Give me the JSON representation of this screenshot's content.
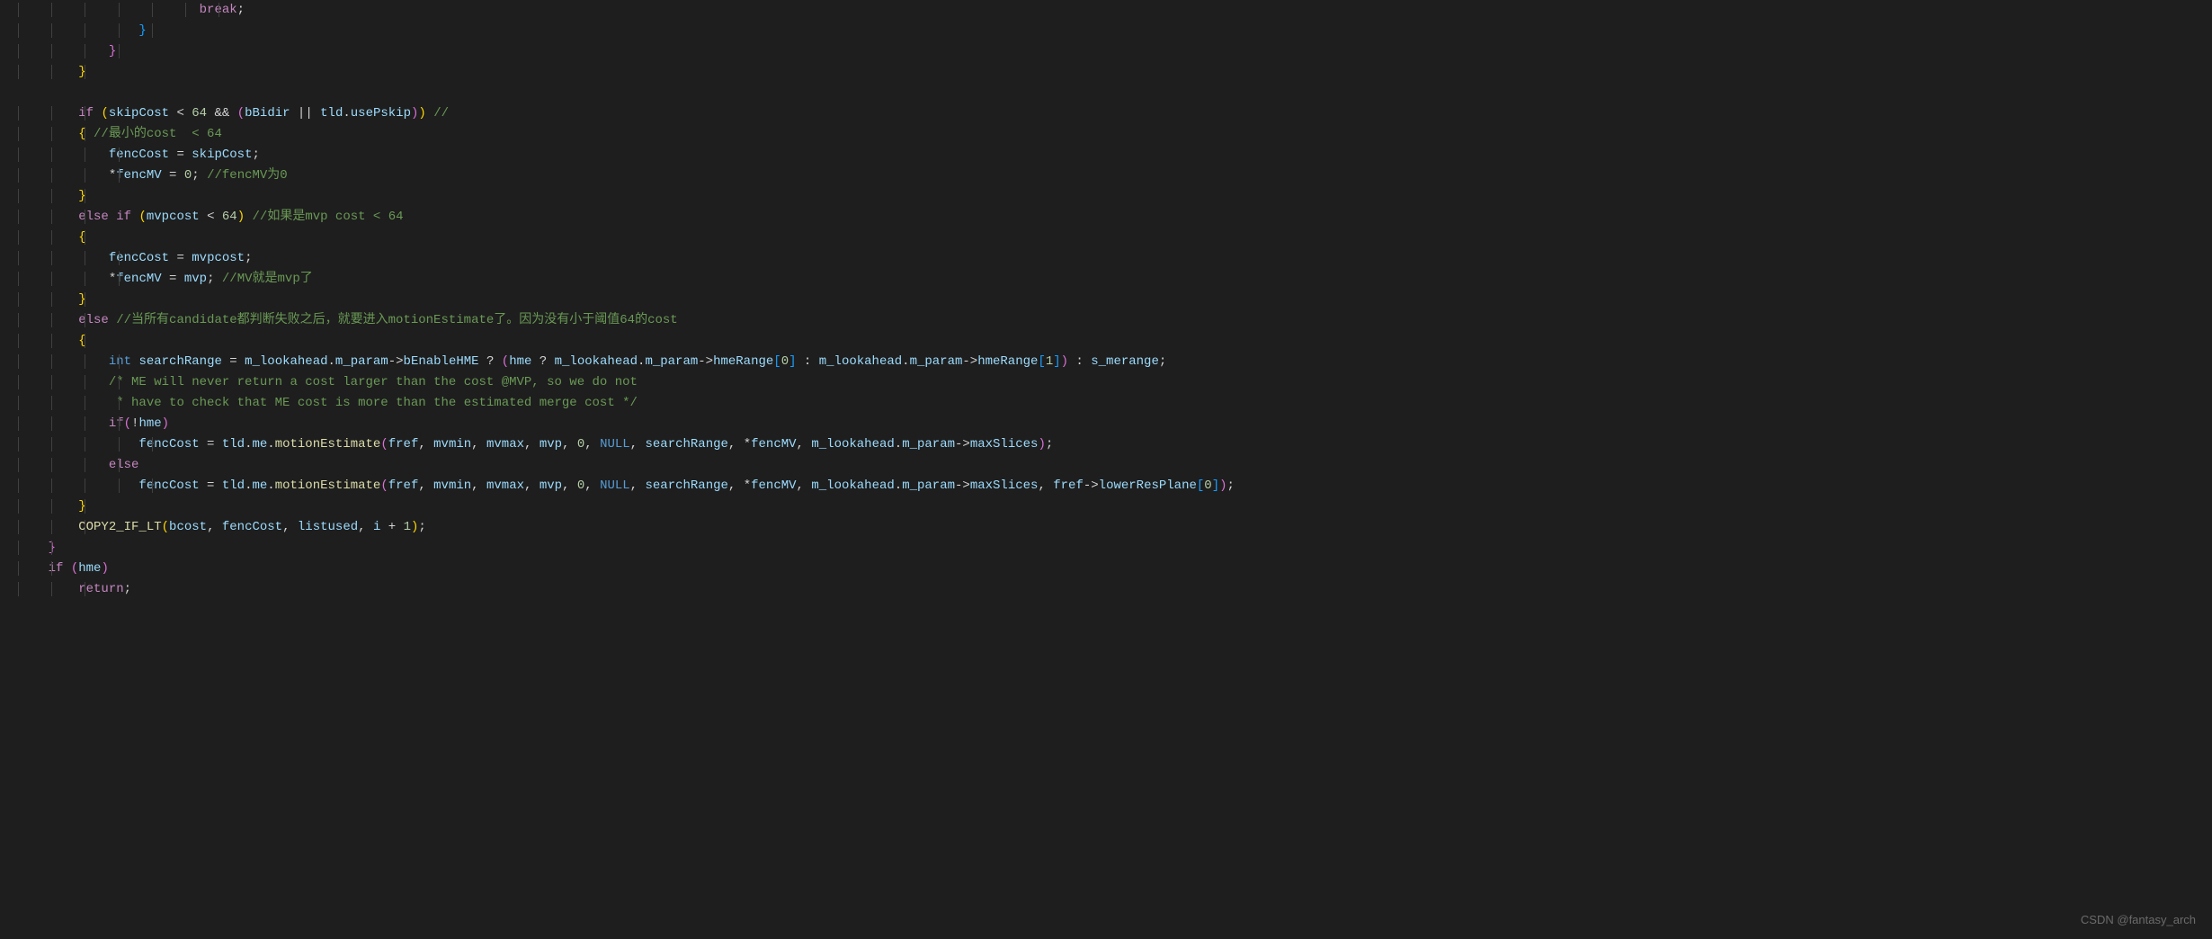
{
  "watermark": "CSDN @fantasy_arch",
  "code": {
    "lines": [
      {
        "indent": 24,
        "tokens": [
          {
            "t": "break",
            "c": "ctrl"
          },
          {
            "t": ";",
            "c": "white"
          }
        ]
      },
      {
        "indent": 16,
        "tokens": [
          {
            "t": "}",
            "c": "br3"
          }
        ]
      },
      {
        "indent": 12,
        "tokens": [
          {
            "t": "}",
            "c": "br2"
          }
        ]
      },
      {
        "indent": 8,
        "tokens": [
          {
            "t": "}",
            "c": "br1"
          }
        ]
      },
      {
        "indent": 0,
        "tokens": []
      },
      {
        "indent": 8,
        "tokens": [
          {
            "t": "if",
            "c": "kw"
          },
          {
            "t": " ",
            "c": "white"
          },
          {
            "t": "(",
            "c": "br1"
          },
          {
            "t": "skipCost",
            "c": "var"
          },
          {
            "t": " < ",
            "c": "white"
          },
          {
            "t": "64",
            "c": "num"
          },
          {
            "t": " && ",
            "c": "white"
          },
          {
            "t": "(",
            "c": "br2"
          },
          {
            "t": "bBidir",
            "c": "var"
          },
          {
            "t": " || ",
            "c": "white"
          },
          {
            "t": "tld",
            "c": "var"
          },
          {
            "t": ".",
            "c": "white"
          },
          {
            "t": "usePskip",
            "c": "prop"
          },
          {
            "t": ")",
            "c": "br2"
          },
          {
            "t": ")",
            "c": "br1"
          },
          {
            "t": " ",
            "c": "white"
          },
          {
            "t": "//",
            "c": "cmt"
          }
        ]
      },
      {
        "indent": 8,
        "tokens": [
          {
            "t": "{",
            "c": "br1"
          },
          {
            "t": " ",
            "c": "white"
          },
          {
            "t": "//最小的cost  < 64",
            "c": "cmt"
          }
        ]
      },
      {
        "indent": 12,
        "tokens": [
          {
            "t": "fencCost",
            "c": "var"
          },
          {
            "t": " = ",
            "c": "white"
          },
          {
            "t": "skipCost",
            "c": "var"
          },
          {
            "t": ";",
            "c": "white"
          }
        ]
      },
      {
        "indent": 12,
        "tokens": [
          {
            "t": "*",
            "c": "white"
          },
          {
            "t": "fencMV",
            "c": "var"
          },
          {
            "t": " = ",
            "c": "white"
          },
          {
            "t": "0",
            "c": "num"
          },
          {
            "t": ";",
            "c": "white"
          },
          {
            "t": " ",
            "c": "white"
          },
          {
            "t": "//fencMV为0",
            "c": "cmt"
          }
        ]
      },
      {
        "indent": 8,
        "tokens": [
          {
            "t": "}",
            "c": "br1"
          }
        ]
      },
      {
        "indent": 8,
        "tokens": [
          {
            "t": "else",
            "c": "kw"
          },
          {
            "t": " ",
            "c": "white"
          },
          {
            "t": "if",
            "c": "kw"
          },
          {
            "t": " ",
            "c": "white"
          },
          {
            "t": "(",
            "c": "br1"
          },
          {
            "t": "mvpcost",
            "c": "var"
          },
          {
            "t": " < ",
            "c": "white"
          },
          {
            "t": "64",
            "c": "num"
          },
          {
            "t": ")",
            "c": "br1"
          },
          {
            "t": " ",
            "c": "white"
          },
          {
            "t": "//如果是mvp cost < 64",
            "c": "cmt"
          }
        ]
      },
      {
        "indent": 8,
        "tokens": [
          {
            "t": "{",
            "c": "br1"
          }
        ]
      },
      {
        "indent": 12,
        "tokens": [
          {
            "t": "fencCost",
            "c": "var"
          },
          {
            "t": " = ",
            "c": "white"
          },
          {
            "t": "mvpcost",
            "c": "var"
          },
          {
            "t": ";",
            "c": "white"
          }
        ]
      },
      {
        "indent": 12,
        "tokens": [
          {
            "t": "*",
            "c": "white"
          },
          {
            "t": "fencMV",
            "c": "var"
          },
          {
            "t": " = ",
            "c": "white"
          },
          {
            "t": "mvp",
            "c": "var"
          },
          {
            "t": ";",
            "c": "white"
          },
          {
            "t": " ",
            "c": "white"
          },
          {
            "t": "//MV就是mvp了",
            "c": "cmt"
          }
        ]
      },
      {
        "indent": 8,
        "tokens": [
          {
            "t": "}",
            "c": "br1"
          }
        ]
      },
      {
        "indent": 8,
        "tokens": [
          {
            "t": "else",
            "c": "kw"
          },
          {
            "t": " ",
            "c": "white"
          },
          {
            "t": "//当所有candidate都判断失败之后，就要进入motionEstimate了。因为没有小于阈值64的cost",
            "c": "cmt"
          }
        ]
      },
      {
        "indent": 8,
        "tokens": [
          {
            "t": "{",
            "c": "br1"
          }
        ]
      },
      {
        "indent": 12,
        "tokens": [
          {
            "t": "int",
            "c": "type"
          },
          {
            "t": " ",
            "c": "white"
          },
          {
            "t": "searchRange",
            "c": "var"
          },
          {
            "t": " = ",
            "c": "white"
          },
          {
            "t": "m_lookahead",
            "c": "var"
          },
          {
            "t": ".",
            "c": "white"
          },
          {
            "t": "m_param",
            "c": "prop"
          },
          {
            "t": "->",
            "c": "white"
          },
          {
            "t": "bEnableHME",
            "c": "prop"
          },
          {
            "t": " ? ",
            "c": "white"
          },
          {
            "t": "(",
            "c": "br2"
          },
          {
            "t": "hme",
            "c": "var"
          },
          {
            "t": " ? ",
            "c": "white"
          },
          {
            "t": "m_lookahead",
            "c": "var"
          },
          {
            "t": ".",
            "c": "white"
          },
          {
            "t": "m_param",
            "c": "prop"
          },
          {
            "t": "->",
            "c": "white"
          },
          {
            "t": "hmeRange",
            "c": "prop"
          },
          {
            "t": "[",
            "c": "br3"
          },
          {
            "t": "0",
            "c": "num"
          },
          {
            "t": "]",
            "c": "br3"
          },
          {
            "t": " : ",
            "c": "white"
          },
          {
            "t": "m_lookahead",
            "c": "var"
          },
          {
            "t": ".",
            "c": "white"
          },
          {
            "t": "m_param",
            "c": "prop"
          },
          {
            "t": "->",
            "c": "white"
          },
          {
            "t": "hmeRange",
            "c": "prop"
          },
          {
            "t": "[",
            "c": "br3"
          },
          {
            "t": "1",
            "c": "num"
          },
          {
            "t": "]",
            "c": "br3"
          },
          {
            "t": ")",
            "c": "br2"
          },
          {
            "t": " : ",
            "c": "white"
          },
          {
            "t": "s_merange",
            "c": "var"
          },
          {
            "t": ";",
            "c": "white"
          }
        ]
      },
      {
        "indent": 12,
        "tokens": [
          {
            "t": "/* ME will never return a cost larger than the cost @MVP, so we do not",
            "c": "cmt"
          }
        ]
      },
      {
        "indent": 12,
        "tokens": [
          {
            "t": " * have to check that ME cost is more than the estimated merge cost */",
            "c": "cmt"
          }
        ]
      },
      {
        "indent": 12,
        "tokens": [
          {
            "t": "if",
            "c": "kw"
          },
          {
            "t": "(",
            "c": "br2"
          },
          {
            "t": "!",
            "c": "white"
          },
          {
            "t": "hme",
            "c": "var"
          },
          {
            "t": ")",
            "c": "br2"
          }
        ]
      },
      {
        "indent": 16,
        "tokens": [
          {
            "t": "fencCost",
            "c": "var"
          },
          {
            "t": " = ",
            "c": "white"
          },
          {
            "t": "tld",
            "c": "var"
          },
          {
            "t": ".",
            "c": "white"
          },
          {
            "t": "me",
            "c": "prop"
          },
          {
            "t": ".",
            "c": "white"
          },
          {
            "t": "motionEstimate",
            "c": "fn"
          },
          {
            "t": "(",
            "c": "br2"
          },
          {
            "t": "fref",
            "c": "var"
          },
          {
            "t": ", ",
            "c": "white"
          },
          {
            "t": "mvmin",
            "c": "var"
          },
          {
            "t": ", ",
            "c": "white"
          },
          {
            "t": "mvmax",
            "c": "var"
          },
          {
            "t": ", ",
            "c": "white"
          },
          {
            "t": "mvp",
            "c": "var"
          },
          {
            "t": ", ",
            "c": "white"
          },
          {
            "t": "0",
            "c": "num"
          },
          {
            "t": ", ",
            "c": "white"
          },
          {
            "t": "NULL",
            "c": "const"
          },
          {
            "t": ", ",
            "c": "white"
          },
          {
            "t": "searchRange",
            "c": "var"
          },
          {
            "t": ", ",
            "c": "white"
          },
          {
            "t": "*",
            "c": "white"
          },
          {
            "t": "fencMV",
            "c": "var"
          },
          {
            "t": ", ",
            "c": "white"
          },
          {
            "t": "m_lookahead",
            "c": "var"
          },
          {
            "t": ".",
            "c": "white"
          },
          {
            "t": "m_param",
            "c": "prop"
          },
          {
            "t": "->",
            "c": "white"
          },
          {
            "t": "maxSlices",
            "c": "prop"
          },
          {
            "t": ")",
            "c": "br2"
          },
          {
            "t": ";",
            "c": "white"
          }
        ]
      },
      {
        "indent": 12,
        "tokens": [
          {
            "t": "else",
            "c": "kw"
          }
        ]
      },
      {
        "indent": 16,
        "tokens": [
          {
            "t": "fencCost",
            "c": "var"
          },
          {
            "t": " = ",
            "c": "white"
          },
          {
            "t": "tld",
            "c": "var"
          },
          {
            "t": ".",
            "c": "white"
          },
          {
            "t": "me",
            "c": "prop"
          },
          {
            "t": ".",
            "c": "white"
          },
          {
            "t": "motionEstimate",
            "c": "fn"
          },
          {
            "t": "(",
            "c": "br2"
          },
          {
            "t": "fref",
            "c": "var"
          },
          {
            "t": ", ",
            "c": "white"
          },
          {
            "t": "mvmin",
            "c": "var"
          },
          {
            "t": ", ",
            "c": "white"
          },
          {
            "t": "mvmax",
            "c": "var"
          },
          {
            "t": ", ",
            "c": "white"
          },
          {
            "t": "mvp",
            "c": "var"
          },
          {
            "t": ", ",
            "c": "white"
          },
          {
            "t": "0",
            "c": "num"
          },
          {
            "t": ", ",
            "c": "white"
          },
          {
            "t": "NULL",
            "c": "const"
          },
          {
            "t": ", ",
            "c": "white"
          },
          {
            "t": "searchRange",
            "c": "var"
          },
          {
            "t": ", ",
            "c": "white"
          },
          {
            "t": "*",
            "c": "white"
          },
          {
            "t": "fencMV",
            "c": "var"
          },
          {
            "t": ", ",
            "c": "white"
          },
          {
            "t": "m_lookahead",
            "c": "var"
          },
          {
            "t": ".",
            "c": "white"
          },
          {
            "t": "m_param",
            "c": "prop"
          },
          {
            "t": "->",
            "c": "white"
          },
          {
            "t": "maxSlices",
            "c": "prop"
          },
          {
            "t": ", ",
            "c": "white"
          },
          {
            "t": "fref",
            "c": "var"
          },
          {
            "t": "->",
            "c": "white"
          },
          {
            "t": "lowerResPlane",
            "c": "prop"
          },
          {
            "t": "[",
            "c": "br3"
          },
          {
            "t": "0",
            "c": "num"
          },
          {
            "t": "]",
            "c": "br3"
          },
          {
            "t": ")",
            "c": "br2"
          },
          {
            "t": ";",
            "c": "white"
          }
        ]
      },
      {
        "indent": 8,
        "tokens": [
          {
            "t": "}",
            "c": "br1"
          }
        ]
      },
      {
        "indent": 8,
        "tokens": [
          {
            "t": "COPY2_IF_LT",
            "c": "fn"
          },
          {
            "t": "(",
            "c": "br1"
          },
          {
            "t": "bcost",
            "c": "var"
          },
          {
            "t": ", ",
            "c": "white"
          },
          {
            "t": "fencCost",
            "c": "var"
          },
          {
            "t": ", ",
            "c": "white"
          },
          {
            "t": "listused",
            "c": "var"
          },
          {
            "t": ", ",
            "c": "white"
          },
          {
            "t": "i",
            "c": "var"
          },
          {
            "t": " + ",
            "c": "white"
          },
          {
            "t": "1",
            "c": "num"
          },
          {
            "t": ")",
            "c": "br1"
          },
          {
            "t": ";",
            "c": "white"
          }
        ]
      },
      {
        "indent": 4,
        "tokens": [
          {
            "t": "}",
            "c": "br2"
          }
        ]
      },
      {
        "indent": 4,
        "tokens": [
          {
            "t": "if",
            "c": "kw"
          },
          {
            "t": " ",
            "c": "white"
          },
          {
            "t": "(",
            "c": "br2"
          },
          {
            "t": "hme",
            "c": "var"
          },
          {
            "t": ")",
            "c": "br2"
          }
        ]
      },
      {
        "indent": 8,
        "tokens": [
          {
            "t": "return",
            "c": "ctrl"
          },
          {
            "t": ";",
            "c": "white"
          }
        ]
      }
    ]
  }
}
